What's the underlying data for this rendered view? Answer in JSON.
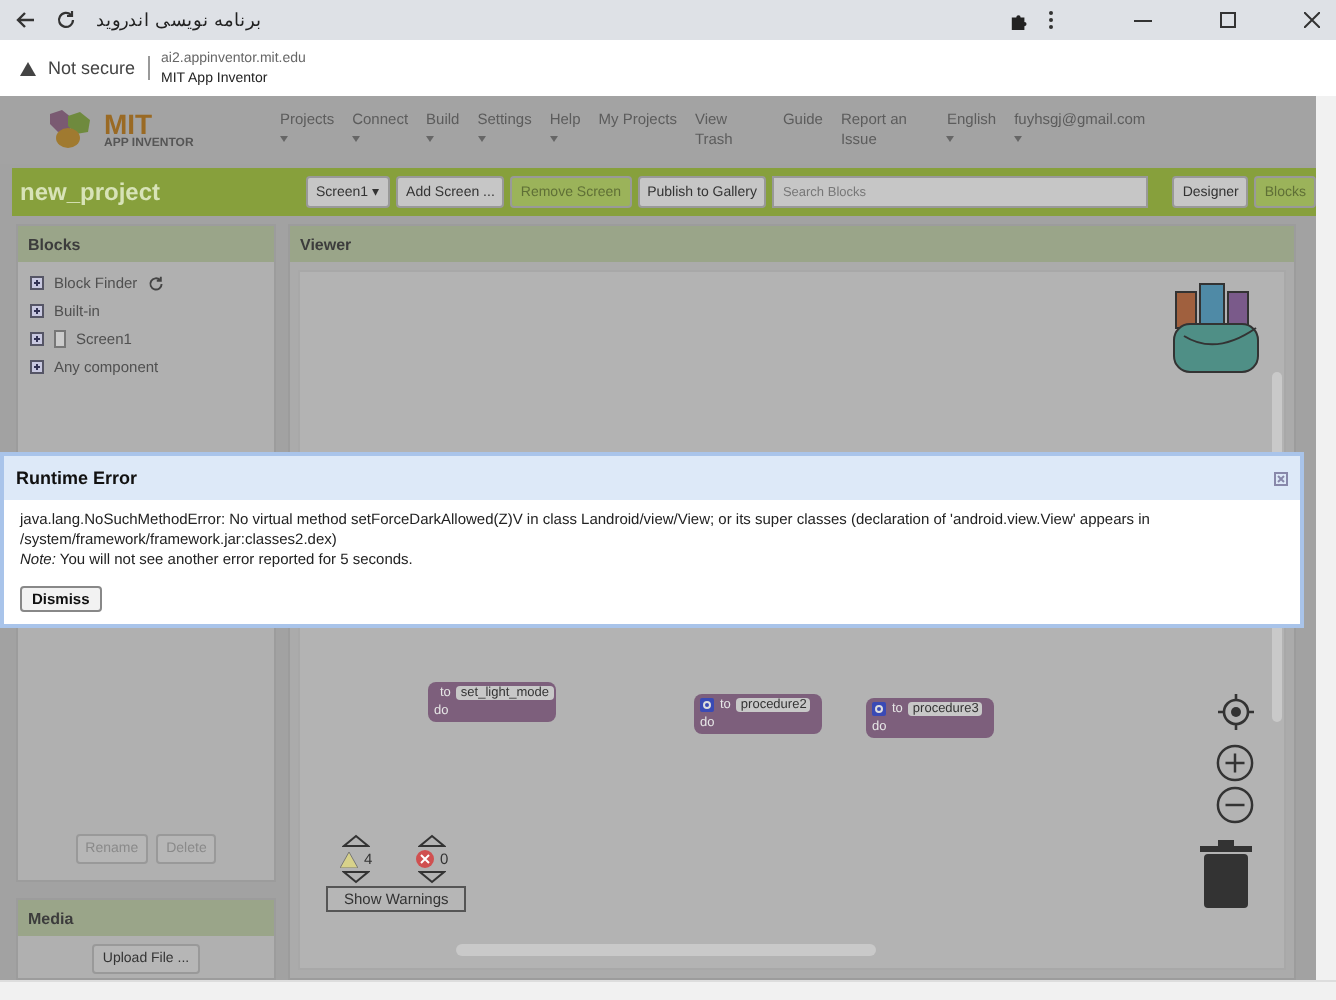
{
  "browser": {
    "tab_title": "برنامه نویسی اندروید",
    "security": "Not secure",
    "url": "ai2.appinventor.mit.edu",
    "page_title": "MIT App Inventor"
  },
  "header": {
    "logo": {
      "line1": "MIT",
      "line2": "APP INVENTOR"
    },
    "menu": [
      {
        "label": "Projects",
        "dropdown": true
      },
      {
        "label": "Connect",
        "dropdown": true
      },
      {
        "label": "Build",
        "dropdown": true
      },
      {
        "label": "Settings",
        "dropdown": true
      },
      {
        "label": "Help",
        "dropdown": true
      },
      {
        "label": "My Projects",
        "dropdown": false
      },
      {
        "label": "View Trash",
        "dropdown": false
      },
      {
        "label": "Guide",
        "dropdown": false
      },
      {
        "label": "Report an Issue",
        "dropdown": false
      },
      {
        "label": "English",
        "dropdown": true
      },
      {
        "label": "fuyhsgj@gmail.com",
        "dropdown": true
      }
    ]
  },
  "toolbar": {
    "project_name": "new_project",
    "buttons": [
      {
        "label": "Screen1 ▾",
        "disabled": false
      },
      {
        "label": "Add Screen ...",
        "disabled": false
      },
      {
        "label": "Remove Screen",
        "disabled": true
      },
      {
        "label": "Publish to Gallery",
        "disabled": false
      }
    ],
    "search": {
      "placeholder": "Search Blocks"
    },
    "views": [
      {
        "label": "Designer",
        "selected": false
      },
      {
        "label": "Blocks",
        "selected": true
      }
    ]
  },
  "blocks_panel": {
    "title": "Blocks",
    "items": [
      {
        "label": "Block Finder",
        "kind": "finder"
      },
      {
        "label": "Built-in",
        "kind": "plain"
      },
      {
        "label": "Screen1",
        "kind": "screen"
      },
      {
        "label": "Any component",
        "kind": "plain"
      }
    ],
    "buttons": [
      {
        "label": "Rename",
        "disabled": true
      },
      {
        "label": "Delete",
        "disabled": true
      }
    ]
  },
  "media_panel": {
    "title": "Media",
    "button": "Upload File ..."
  },
  "viewer": {
    "title": "Viewer",
    "blocks": [
      {
        "keyword": "to",
        "name": "set_light_mode",
        "body": "do"
      },
      {
        "keyword": "to",
        "name": "procedure2",
        "body": "do"
      },
      {
        "keyword": "to",
        "name": "procedure3",
        "body": "do"
      }
    ],
    "warnings": "4",
    "errors": "0",
    "show_warnings": "Show Warnings"
  },
  "dialog": {
    "title": "Runtime Error",
    "message": "java.lang.NoSuchMethodError: No virtual method setForceDarkAllowed(Z)V in class Landroid/view/View; or its super classes (declaration of 'android.view.View' appears in /system/framework/framework.jar:classes2.dex)",
    "note": "*Note:* You will not see another error reported for 5 seconds.",
    "button": "Dismiss"
  }
}
